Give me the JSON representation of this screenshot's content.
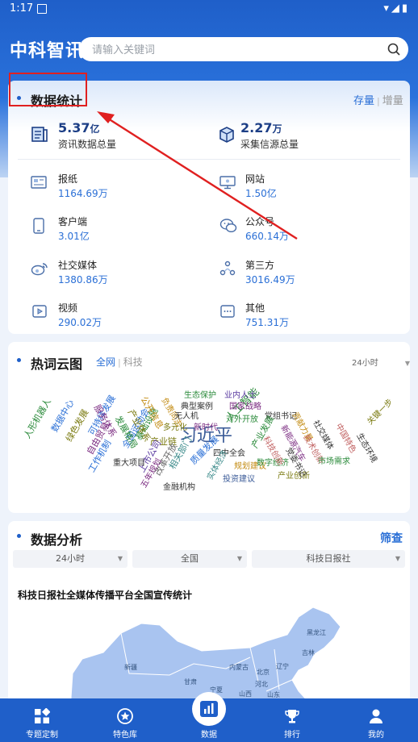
{
  "status_bar": {
    "time": "1:17"
  },
  "app_title": "中科智讯",
  "search": {
    "placeholder": "请输入关键词",
    "value": ""
  },
  "stats": {
    "title": "数据统计",
    "toggle": {
      "active": "存量",
      "inactive": "增量"
    },
    "totals": [
      {
        "value": "5.37",
        "unit": "亿",
        "label": "资讯数据总量",
        "icon": "document-icon"
      },
      {
        "value": "2.27",
        "unit": "万",
        "label": "采集信源总量",
        "icon": "box-icon"
      }
    ],
    "items": [
      {
        "name": "报纸",
        "value": "1164.69万",
        "icon": "newspaper-icon"
      },
      {
        "name": "网站",
        "value": "1.50亿",
        "icon": "monitor-icon"
      },
      {
        "name": "客户端",
        "value": "3.01亿",
        "icon": "phone-icon"
      },
      {
        "name": "公众号",
        "value": "660.14万",
        "icon": "wechat-icon"
      },
      {
        "name": "社交媒体",
        "value": "1380.86万",
        "icon": "weibo-icon"
      },
      {
        "name": "第三方",
        "value": "3016.49万",
        "icon": "share-icon"
      },
      {
        "name": "视频",
        "value": "290.02万",
        "icon": "video-icon"
      },
      {
        "name": "其他",
        "value": "751.31万",
        "icon": "more-icon"
      }
    ]
  },
  "hotwords": {
    "title": "热词云图",
    "tabs": {
      "active": "全网",
      "inactive": "科技"
    },
    "time_filter": "24小时",
    "words": [
      {
        "text": "习近平",
        "color": "#3b5b98"
      },
      {
        "text": "人工智能",
        "color": "#2a8a3a"
      },
      {
        "text": "产业链",
        "color": "#7a7a10"
      },
      {
        "text": "四中全会",
        "color": "#333333"
      },
      {
        "text": "质量发展",
        "color": "#2a6fd6"
      },
      {
        "text": "相关部门",
        "color": "#3a8a8a"
      },
      {
        "text": "改革开放",
        "color": "#6a6a6a"
      },
      {
        "text": "上市公司",
        "color": "#5a3aa0"
      },
      {
        "text": "重大项目",
        "color": "#333333"
      },
      {
        "text": "基础设施",
        "color": "#2a8a3a"
      },
      {
        "text": "全国运动会",
        "color": "#2a6fd6"
      },
      {
        "text": "可持续发展",
        "color": "#2a6fd6"
      },
      {
        "text": "自由贸易",
        "color": "#7a2a80"
      },
      {
        "text": "工作机制",
        "color": "#2a6fd6"
      },
      {
        "text": "绿色发展",
        "color": "#7a7a10"
      },
      {
        "text": "数据中心",
        "color": "#2a6fd6"
      },
      {
        "text": "人形机器人",
        "color": "#2a8a3a"
      },
      {
        "text": "服务体系",
        "color": "#7a2a80"
      },
      {
        "text": "发展格局",
        "color": "#2a8a3a"
      },
      {
        "text": "产业体系",
        "color": "#7a7a10"
      },
      {
        "text": "公开信息",
        "color": "#c28a10"
      },
      {
        "text": "负责同志",
        "color": "#c28a10"
      },
      {
        "text": "多元化",
        "color": "#7a7a10"
      },
      {
        "text": "新时代",
        "color": "#7a2a80"
      },
      {
        "text": "无人机",
        "color": "#333333"
      },
      {
        "text": "典型案例",
        "color": "#333333"
      },
      {
        "text": "生态保护",
        "color": "#2a8a3a"
      },
      {
        "text": "业内人士",
        "color": "#5a3aa0"
      },
      {
        "text": "国家战略",
        "color": "#7a2a80"
      },
      {
        "text": "对外开放",
        "color": "#2a8a3a"
      },
      {
        "text": "党组书记",
        "color": "#333333"
      },
      {
        "text": "产业发展",
        "color": "#2a8a3a"
      },
      {
        "text": "规划建议",
        "color": "#c28a10"
      },
      {
        "text": "数字经济",
        "color": "#2a8a3a"
      },
      {
        "text": "投资建议",
        "color": "#3b5b98"
      },
      {
        "text": "产业创新",
        "color": "#7a7a10"
      },
      {
        "text": "金融机构",
        "color": "#333333"
      },
      {
        "text": "五年规划",
        "color": "#7a2a80"
      },
      {
        "text": "实体经济",
        "color": "#3a8a8a"
      },
      {
        "text": "科技创新",
        "color": "#c06060"
      },
      {
        "text": "新能源汽车",
        "color": "#7a2a80"
      },
      {
        "text": "贡献力量",
        "color": "#c28a10"
      },
      {
        "text": "技术创新",
        "color": "#c06060"
      },
      {
        "text": "社交媒体",
        "color": "#333333"
      },
      {
        "text": "市场需求",
        "color": "#2a8a3a"
      },
      {
        "text": "党委书记",
        "color": "#333333"
      },
      {
        "text": "中国特色",
        "color": "#c06060"
      },
      {
        "text": "生态环境",
        "color": "#333333"
      },
      {
        "text": "关键一步",
        "color": "#7a7a10"
      }
    ]
  },
  "analysis": {
    "title": "数据分析",
    "filter_button": "筛查",
    "dropdowns": [
      "24小时",
      "全国",
      "科技日报社"
    ],
    "map_title": "科技日报社全媒体传播平台全国宣传统计",
    "map_labels": [
      "新疆",
      "黑龙江",
      "吉林",
      "内蒙古",
      "北京",
      "辽宁",
      "甘肃",
      "宁夏",
      "山西",
      "河北",
      "山东"
    ]
  },
  "nav": [
    {
      "label": "专题定制",
      "icon": "grid-icon"
    },
    {
      "label": "特色库",
      "icon": "star-icon"
    },
    {
      "label": "数据",
      "icon": "chart-icon"
    },
    {
      "label": "排行",
      "icon": "trophy-icon"
    },
    {
      "label": "我的",
      "icon": "user-icon"
    }
  ],
  "colors": {
    "primary": "#1f5fc9",
    "accent": "#2a6fd6",
    "annotation": "#e02020"
  }
}
